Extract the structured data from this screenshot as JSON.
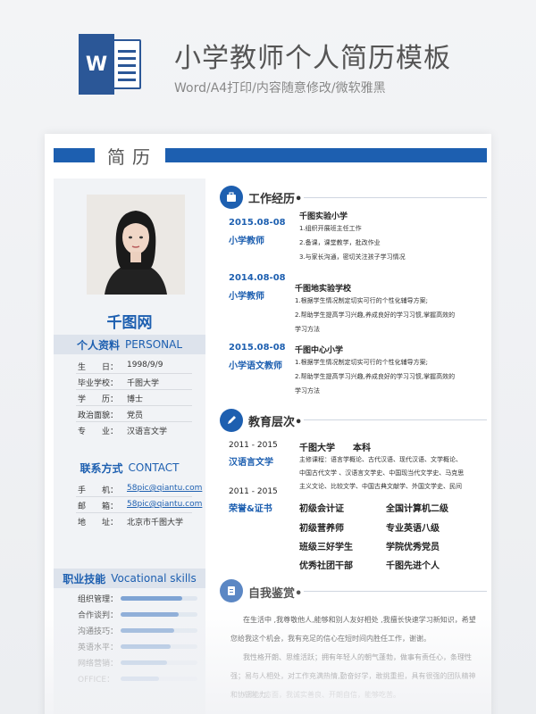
{
  "banner": {
    "icon_letter": "W",
    "title": "小学教师个人简历模板",
    "subtitle": "Word/A4打印/内容随意修改/微软雅黑"
  },
  "resume": {
    "header": "简历",
    "name": "千图网",
    "personal": {
      "title_cn": "个人资料",
      "title_en": "PERSONAL",
      "rows": [
        {
          "label": "生　　日：",
          "value": "1998/9/9"
        },
        {
          "label": "毕业学校：",
          "value": "千图大学"
        },
        {
          "label": "学　　历：",
          "value": "博士"
        },
        {
          "label": "政治面貌：",
          "value": "党员"
        },
        {
          "label": "专　　业：",
          "value": "汉语言文学"
        }
      ]
    },
    "contact": {
      "title_cn": "联系方式",
      "title_en": "CONTACT",
      "rows": [
        {
          "label": "手　　机：",
          "value": "58pic@qiantu.com"
        },
        {
          "label": "邮　　箱：",
          "value": "58pic@qiantu.com"
        },
        {
          "label": "地　　址：",
          "value": "北京市千图大学"
        }
      ]
    },
    "skills": {
      "title_cn": "职业技能",
      "title_en": "Vocational skills",
      "items": [
        {
          "label": "组织管理：",
          "level": 0.8
        },
        {
          "label": "合作谈判：",
          "level": 0.75
        },
        {
          "label": "沟通技巧：",
          "level": 0.7
        },
        {
          "label": "英语水平：",
          "level": 0.65
        },
        {
          "label": "网络营销：",
          "level": 0.6
        },
        {
          "label": "OFFICE：",
          "level": 0.5
        }
      ]
    },
    "work": {
      "title": "工作经历•",
      "entries": [
        {
          "date": "2015.08-08",
          "role": "小学教师",
          "org": "千图实验小学",
          "duties": [
            "1.组织开展班主任工作",
            "2.备课，课堂教学，批改作业",
            "3.与家长沟通，密切关注孩子学习情况"
          ]
        },
        {
          "date": "2014.08-08",
          "role": "小学教师",
          "org": "千图地实验学校",
          "duties": [
            "1.根据学生情况制定切实可行的个性化辅导方案;",
            "2.帮助学生提高学习兴趣,养成良好的学习习惯,掌握高效的",
            "学习方法"
          ]
        },
        {
          "date": "2015.08-08",
          "role": "小学语文教师",
          "org": "千图中心小学",
          "duties": [
            "1.根据学生情况制定切实可行的个性化辅导方案;",
            "2.帮助学生提高学习兴趣,养成良好的学习习惯,掌握高效的",
            "学习方法"
          ]
        }
      ]
    },
    "education": {
      "title": "教育层次•",
      "date": "2011 - 2015",
      "major": "汉语言文学",
      "school": "千图大学　　本科",
      "courses": [
        "主修课程：语言学概论、古代汉语、现代汉语、文学概论、",
        "中国古代文学 、汉语言文学史、中国现当代文学史、马克思",
        "主义文论、比较文学、中国古典文献学、外国文学史、民间"
      ],
      "honor_date": "2011 - 2015",
      "honor_label": "荣誉&证书",
      "honors": [
        "初级会计证",
        "全国计算机二级",
        "初级营养师",
        "专业英语八级",
        "班级三好学生",
        "学院优秀党员",
        "优秀社团干部",
        "千图先进个人"
      ]
    },
    "self_eval": {
      "title": "自我鉴赏•",
      "paragraphs": [
        "在生活中 ,我尊敬他人,能够和别人友好相处 ,我擅长快速学习新知识，希望您给我这个机会，我有充足的信心在短时间内胜任工作，谢谢。",
        "我性格开朗、思维活跃；拥有年轻人的朝气蓬勃，做事有责任心，条理性强；易与人相处，对工作充满热情,勤奋好学，敢挑重担，具有很强的团队精神和协调能力。",
        "在为人方面，我诚实善良、开朗自信，能够吃苦。"
      ]
    }
  },
  "colors": {
    "accent": "#1d5fb0",
    "bar_light": "#7fa4d4"
  }
}
